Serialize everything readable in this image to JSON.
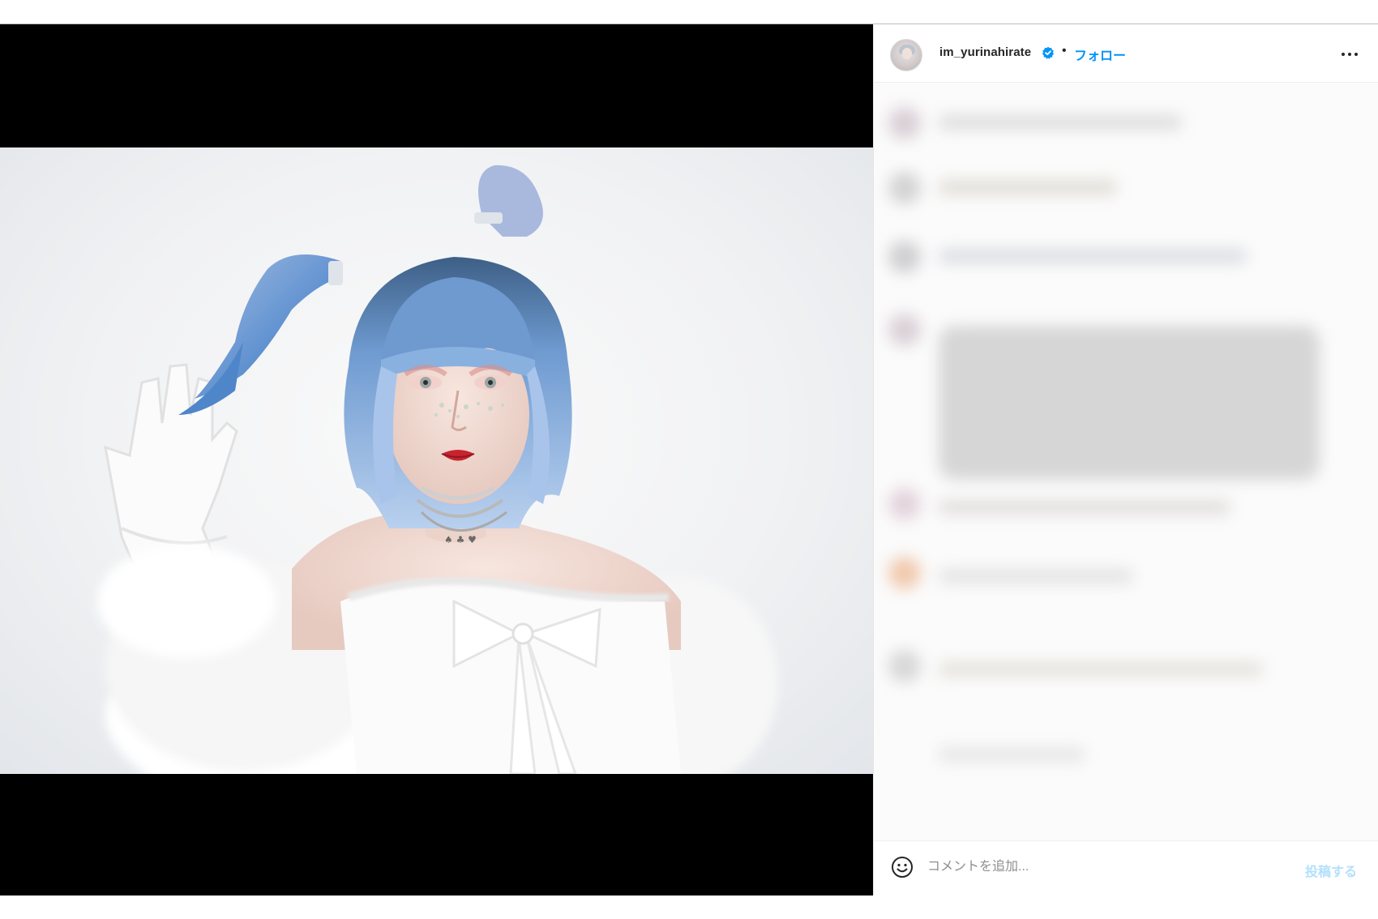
{
  "post": {
    "username": "im_yurinahirate",
    "verified": true,
    "separator": "•",
    "follow_label": "フォロー",
    "more_icon": "more-horizontal-icon",
    "verified_icon": "verified-badge-icon"
  },
  "media": {
    "photo_icon": "portrait-photo"
  },
  "composer": {
    "emoji_icon": "smiley-icon",
    "placeholder": "コメントを追加...",
    "post_label": "投稿する"
  },
  "colors": {
    "accent": "#0095f6",
    "accent_disabled": "#b2dffc",
    "text": "#262626",
    "muted": "#8e8e8e"
  }
}
